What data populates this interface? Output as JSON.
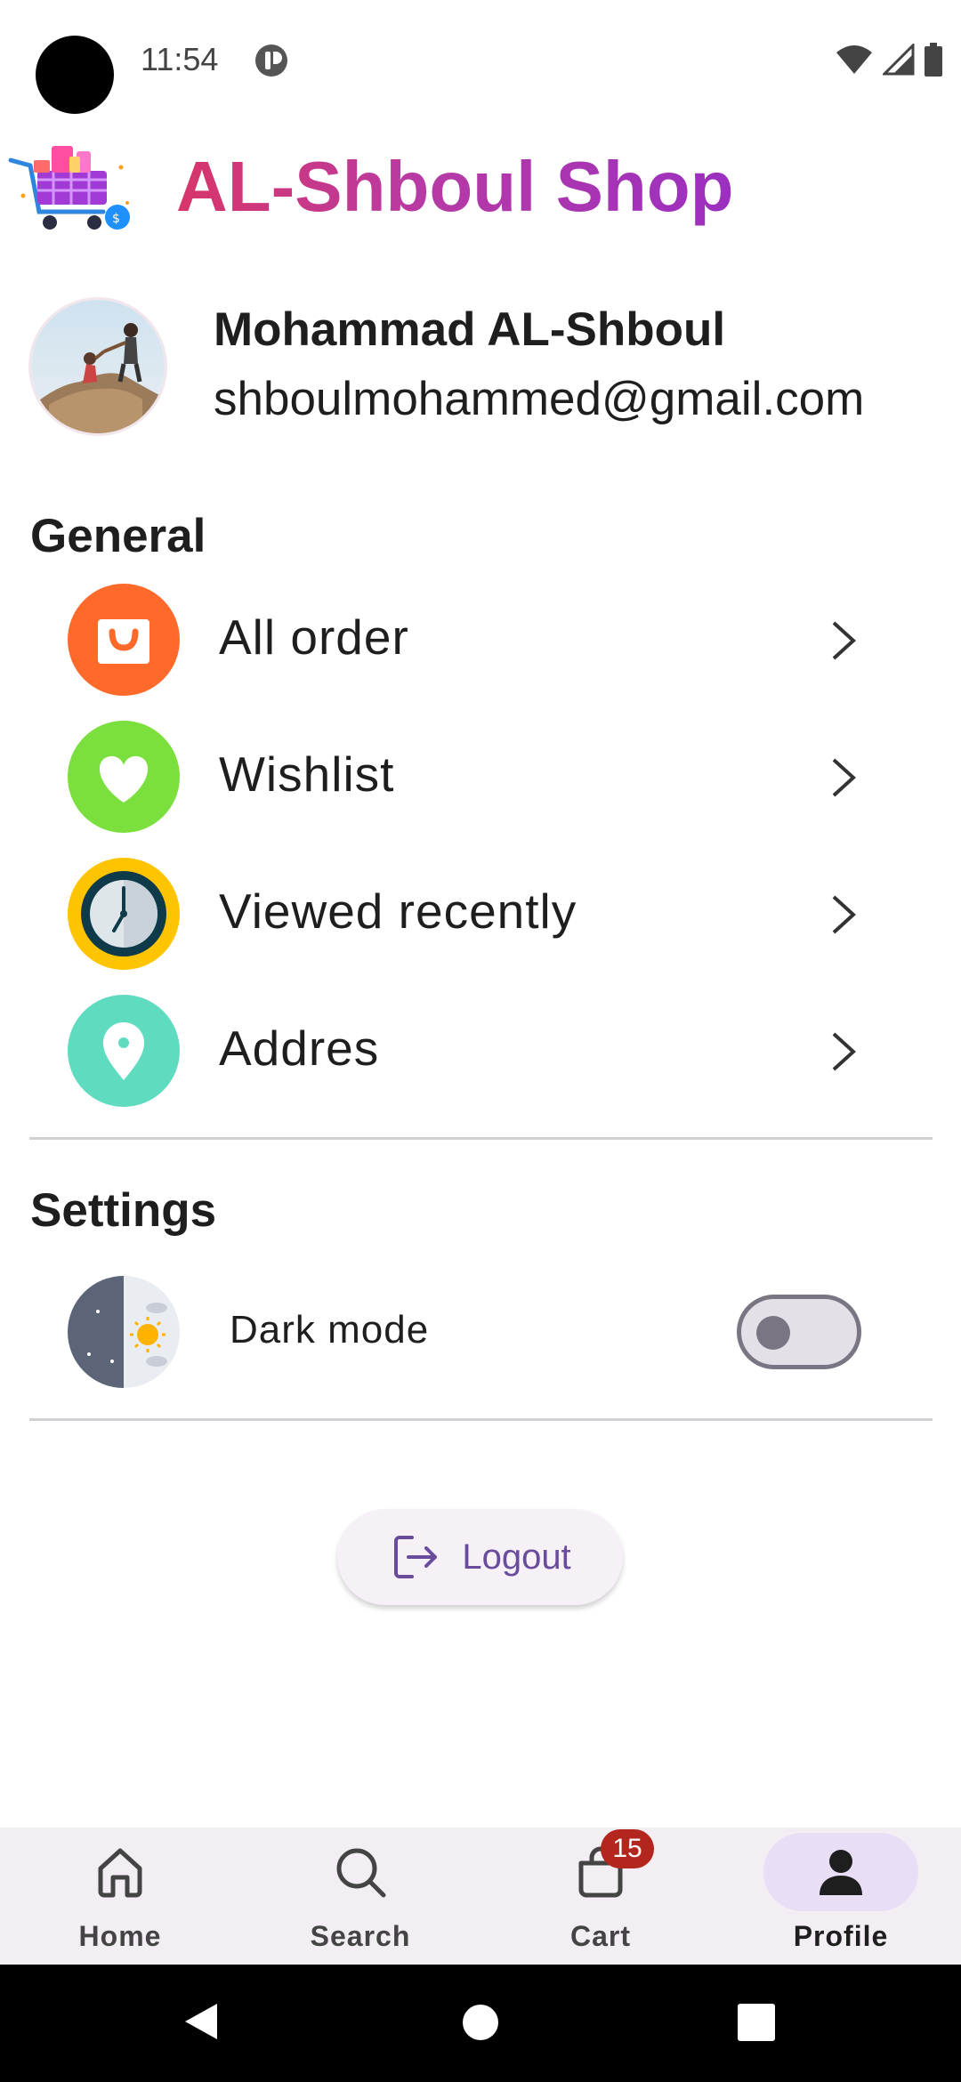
{
  "status_bar": {
    "time": "11:54"
  },
  "header": {
    "title": "AL-Shboul Shop"
  },
  "profile": {
    "name": "Mohammad AL-Shboul",
    "email": "shboulmohammed@gmail.com"
  },
  "general": {
    "title": "General",
    "items": [
      {
        "label": "All order",
        "icon": "shopping-bag-icon",
        "color": "#ff6a2b"
      },
      {
        "label": "Wishlist",
        "icon": "heart-icon",
        "color": "#7be03d"
      },
      {
        "label": "Viewed recently",
        "icon": "clock-icon",
        "color": "#ffc400"
      },
      {
        "label": "Addres",
        "icon": "location-pin-icon",
        "color": "#5fdcc0"
      }
    ]
  },
  "settings": {
    "title": "Settings",
    "dark_mode": {
      "label": "Dark mode",
      "enabled": false
    }
  },
  "logout": {
    "label": "Logout"
  },
  "bottom_nav": {
    "items": [
      {
        "label": "Home",
        "icon": "home-icon"
      },
      {
        "label": "Search",
        "icon": "search-icon"
      },
      {
        "label": "Cart",
        "icon": "cart-icon",
        "badge": "15"
      },
      {
        "label": "Profile",
        "icon": "person-icon",
        "active": true
      }
    ]
  },
  "colors": {
    "title_gradient_start": "#d8366a",
    "title_gradient_end": "#9b2fc0",
    "accent": "#6a4c9c",
    "badge": "#b3261e"
  }
}
